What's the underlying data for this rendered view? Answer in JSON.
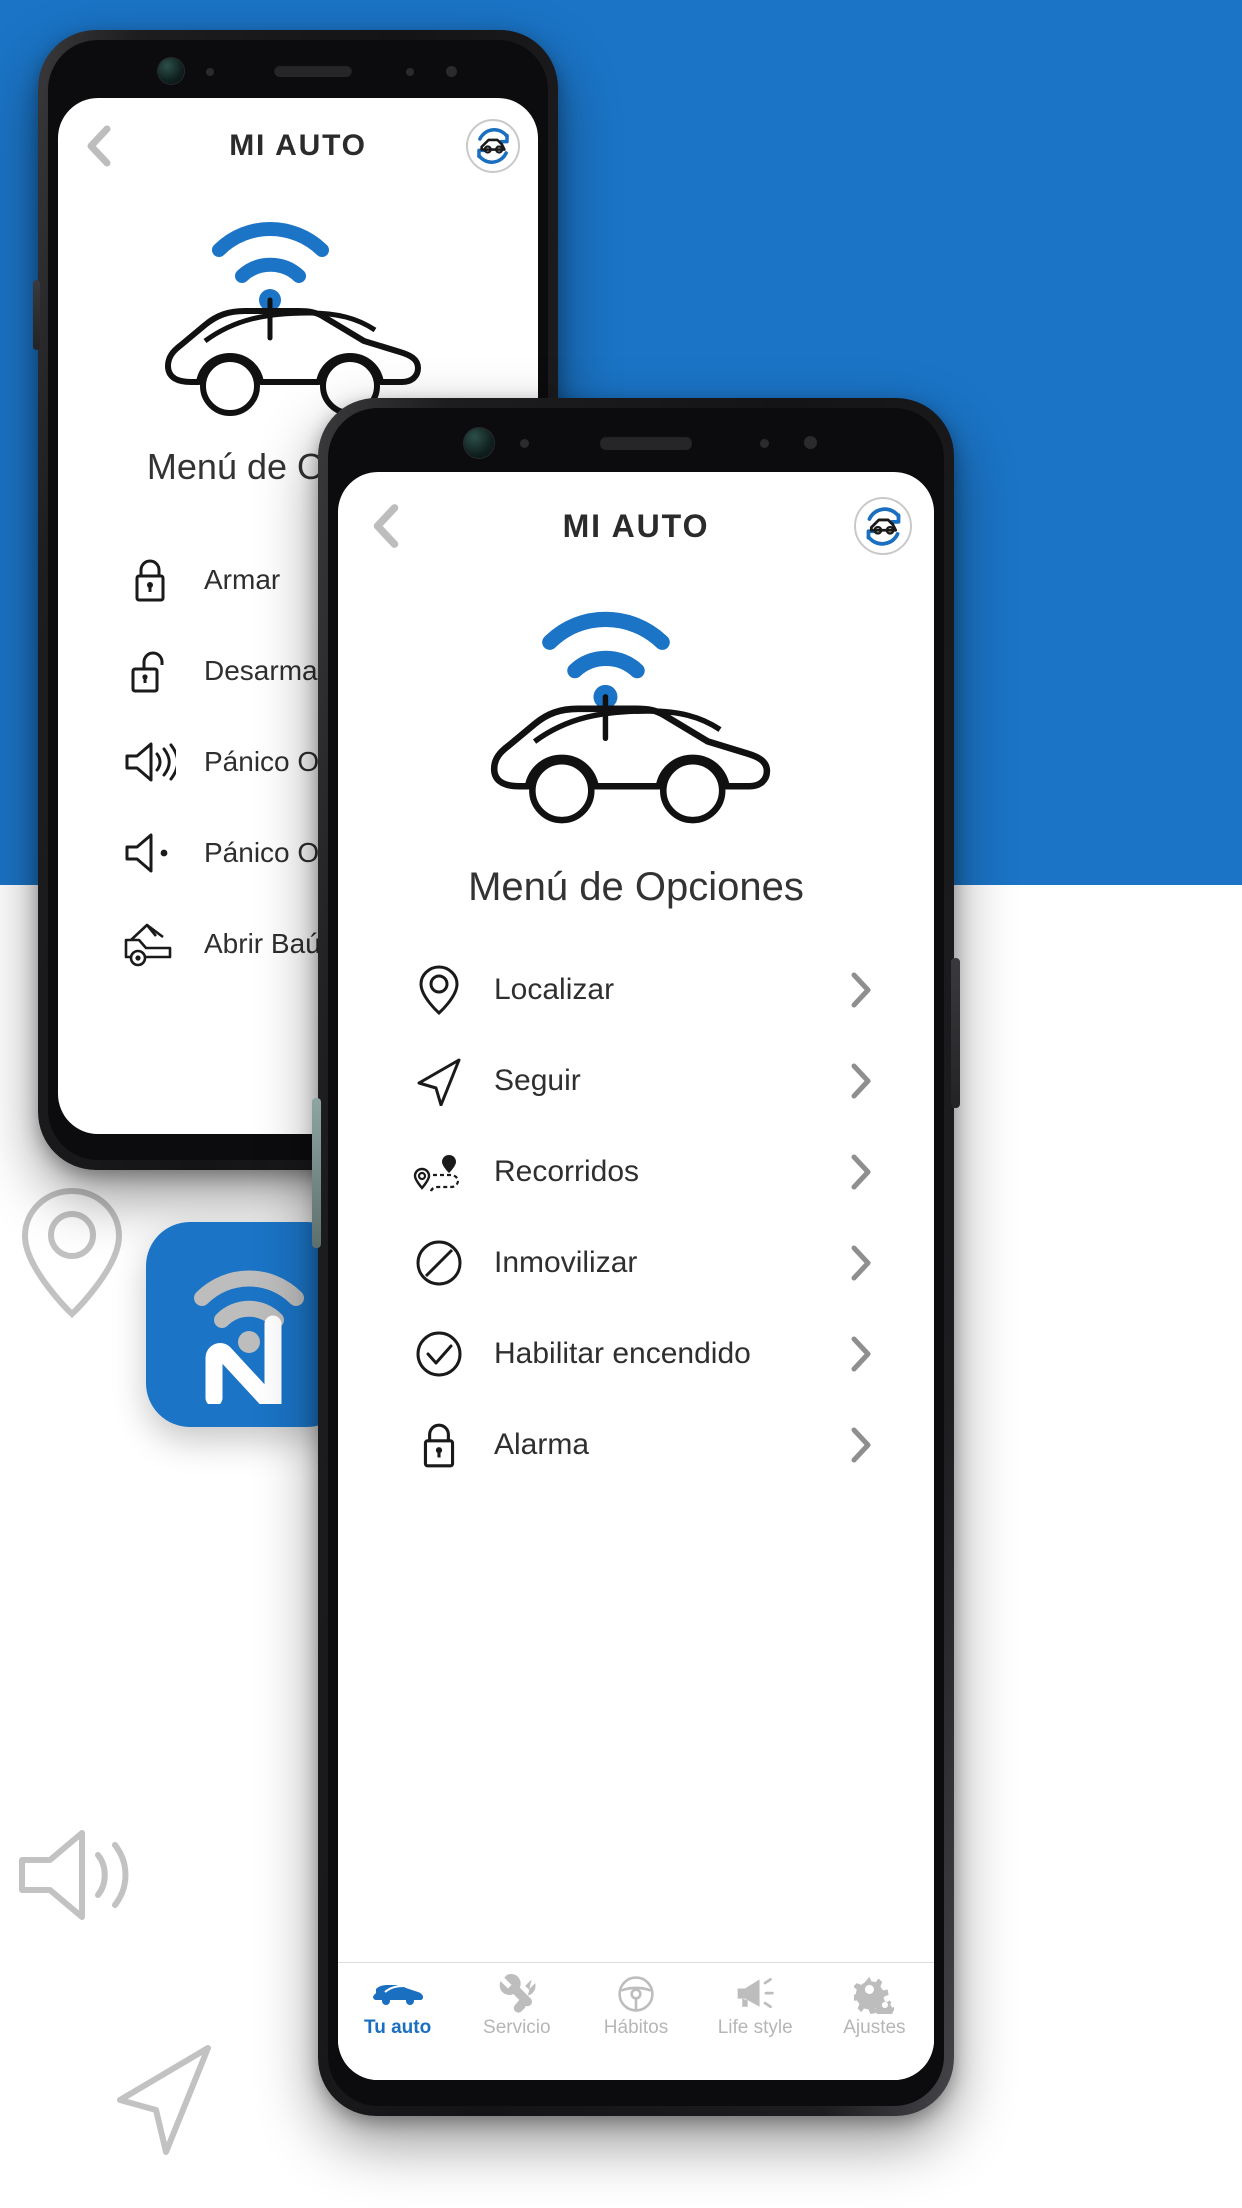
{
  "theme": {
    "brand_blue": "#1b74c6",
    "accent_blue": "#1b6fc0",
    "icon_gray": "#c2c2c2",
    "text_dark": "#2f2f2f"
  },
  "back_phone": {
    "appbar": {
      "back_icon": "chevron-left-icon",
      "title": "MI AUTO",
      "sync_icon": "car-sync-icon"
    },
    "hero_icon": "connected-car-icon",
    "section_title": "Menú de Opciones",
    "menu": [
      {
        "icon": "lock-closed-icon",
        "label": "Armar"
      },
      {
        "icon": "lock-open-icon",
        "label": "Desarmar"
      },
      {
        "icon": "speaker-waves-icon",
        "label": "Pánico ON"
      },
      {
        "icon": "speaker-muted-icon",
        "label": "Pánico OFF"
      },
      {
        "icon": "car-trunk-open-icon",
        "label": "Abrir Baúl"
      }
    ]
  },
  "front_phone": {
    "appbar": {
      "back_icon": "chevron-left-icon",
      "title": "MI AUTO",
      "sync_icon": "car-sync-icon"
    },
    "hero_icon": "connected-car-icon",
    "section_title": "Menú de Opciones",
    "menu": [
      {
        "icon": "map-pin-icon",
        "label": "Localizar",
        "chevron": "chevron-right-icon"
      },
      {
        "icon": "navigation-arrow-icon",
        "label": "Seguir",
        "chevron": "chevron-right-icon"
      },
      {
        "icon": "route-trip-icon",
        "label": "Recorridos",
        "chevron": "chevron-right-icon"
      },
      {
        "icon": "circle-slash-icon",
        "label": "Inmovilizar",
        "chevron": "chevron-right-icon"
      },
      {
        "icon": "circle-check-icon",
        "label": "Habilitar encendido",
        "chevron": "chevron-right-icon"
      },
      {
        "icon": "lock-closed-icon",
        "label": "Alarma",
        "chevron": "chevron-right-icon"
      }
    ],
    "tabs": [
      {
        "icon": "car-icon",
        "label": "Tu auto",
        "active": true
      },
      {
        "icon": "tools-wrench-icon",
        "label": "Servicio",
        "active": false
      },
      {
        "icon": "steering-wheel-icon",
        "label": "Hábitos",
        "active": false
      },
      {
        "icon": "megaphone-icon",
        "label": "Life style",
        "active": false
      },
      {
        "icon": "gears-icon",
        "label": "Ajustes",
        "active": false
      }
    ]
  },
  "app_tile": {
    "icon": "nextel-wifi-n-logo"
  },
  "decorations": [
    {
      "icon": "map-pin-outline-icon"
    },
    {
      "icon": "speaker-waves-outline-icon"
    },
    {
      "icon": "navigation-arrow-outline-icon"
    }
  ]
}
